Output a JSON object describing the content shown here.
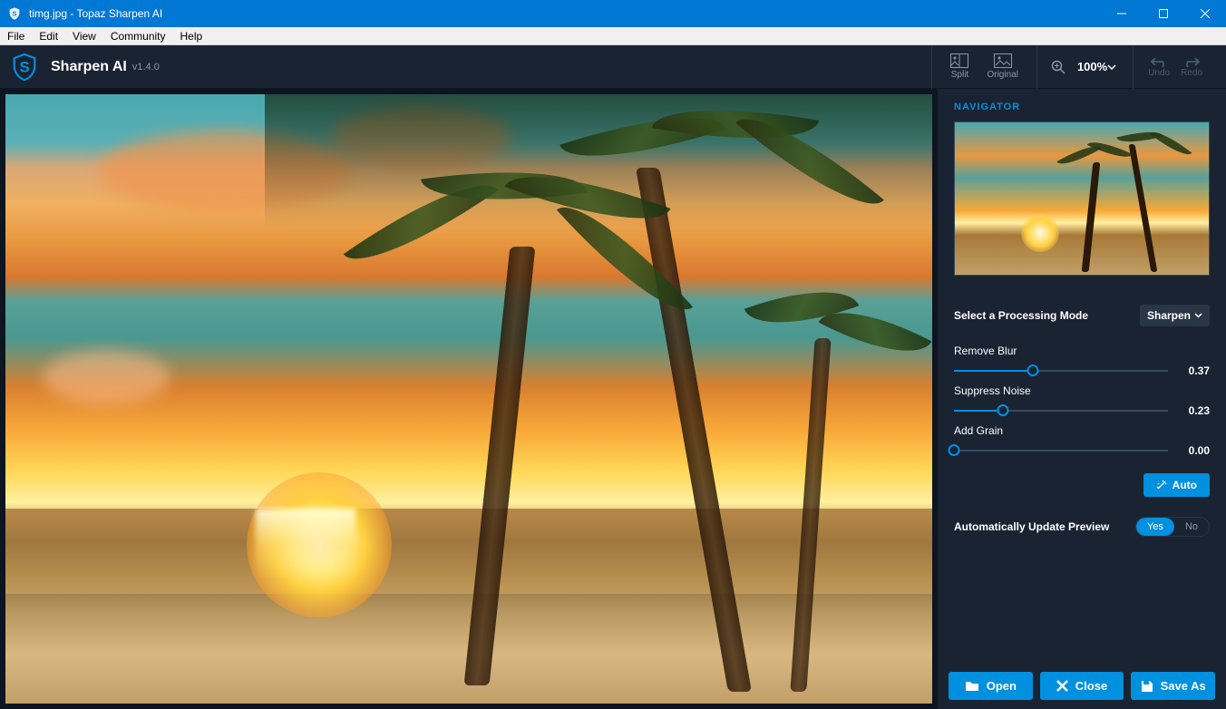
{
  "window": {
    "title": "timg.jpg - Topaz Sharpen AI"
  },
  "menubar": {
    "items": [
      "File",
      "Edit",
      "View",
      "Community",
      "Help"
    ]
  },
  "app": {
    "name": "Sharpen AI",
    "version": "v1.4.0"
  },
  "toolbar": {
    "split_label": "Split",
    "original_label": "Original",
    "zoom_level": "100%",
    "undo_label": "Undo",
    "redo_label": "Redo"
  },
  "sidebar": {
    "navigator_header": "NAVIGATOR",
    "mode": {
      "label": "Select a Processing Mode",
      "selected": "Sharpen"
    },
    "sliders": [
      {
        "label": "Remove Blur",
        "value": "0.37",
        "pct": 37
      },
      {
        "label": "Suppress Noise",
        "value": "0.23",
        "pct": 23
      },
      {
        "label": "Add Grain",
        "value": "0.00",
        "pct": 0
      }
    ],
    "auto_label": "Auto",
    "preview": {
      "label": "Automatically Update Preview",
      "yes": "Yes",
      "no": "No"
    },
    "footer": {
      "open": "Open",
      "close": "Close",
      "save_as": "Save As"
    }
  }
}
